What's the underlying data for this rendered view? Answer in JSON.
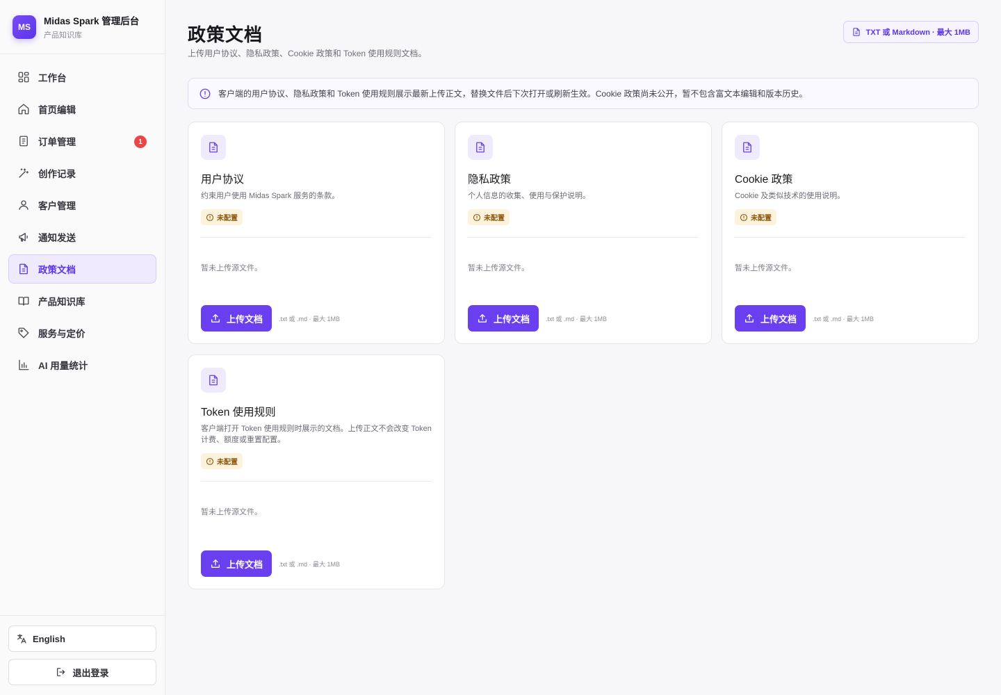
{
  "brand": {
    "logo": "MS",
    "title": "Midas Spark 管理后台",
    "subtitle": "产品知识库"
  },
  "nav": {
    "items": [
      {
        "label": "工作台",
        "icon": "dashboard-icon"
      },
      {
        "label": "首页编辑",
        "icon": "home-icon"
      },
      {
        "label": "订单管理",
        "icon": "order-icon",
        "badge": "1"
      },
      {
        "label": "创作记录",
        "icon": "magic-wand-icon"
      },
      {
        "label": "客户管理",
        "icon": "user-icon"
      },
      {
        "label": "通知发送",
        "icon": "megaphone-icon"
      },
      {
        "label": "政策文档",
        "icon": "document-icon",
        "active": true
      },
      {
        "label": "产品知识库",
        "icon": "book-icon"
      },
      {
        "label": "服务与定价",
        "icon": "tag-icon"
      },
      {
        "label": "AI 用量统计",
        "icon": "bar-chart-icon"
      }
    ]
  },
  "footer": {
    "language_label": "English",
    "logout_label": "退出登录"
  },
  "header": {
    "title": "政策文档",
    "subtitle": "上传用户协议、隐私政策、Cookie 政策和 Token 使用规则文档。",
    "format_chip": "TXT 或 Markdown · 最大 1MB"
  },
  "notice": {
    "text": "客户端的用户协议、隐私政策和 Token 使用规则展示最新上传正文，替换文件后下次打开或刷新生效。Cookie 政策尚未公开，暂不包含富文本编辑和版本历史。"
  },
  "cards": [
    {
      "title": "用户协议",
      "description": "约束用户使用 Midas Spark 服务的条款。",
      "status": "未配置",
      "empty_text": "暂未上传源文件。",
      "button_label": "上传文档",
      "hint": ".txt 或 .md · 最大 1MB"
    },
    {
      "title": "隐私政策",
      "description": "个人信息的收集、使用与保护说明。",
      "status": "未配置",
      "empty_text": "暂未上传源文件。",
      "button_label": "上传文档",
      "hint": ".txt 或 .md · 最大 1MB"
    },
    {
      "title": "Cookie 政策",
      "description": "Cookie 及类似技术的使用说明。",
      "status": "未配置",
      "empty_text": "暂未上传源文件。",
      "button_label": "上传文档",
      "hint": ".txt 或 .md · 最大 1MB"
    },
    {
      "title": "Token 使用规则",
      "description": "客户端打开 Token 使用规则时展示的文档。上传正文不会改变 Token 计费、额度或重置配置。",
      "status": "未配置",
      "empty_text": "暂未上传源文件。",
      "button_label": "上传文档",
      "hint": ".txt 或 .md · 最大 1MB"
    }
  ],
  "colors": {
    "accent": "#6a3ff0",
    "accent_soft": "#efeafe",
    "warning_bg": "#fdf2dc",
    "warning_text": "#8a5a10",
    "badge_red": "#ef4444"
  }
}
